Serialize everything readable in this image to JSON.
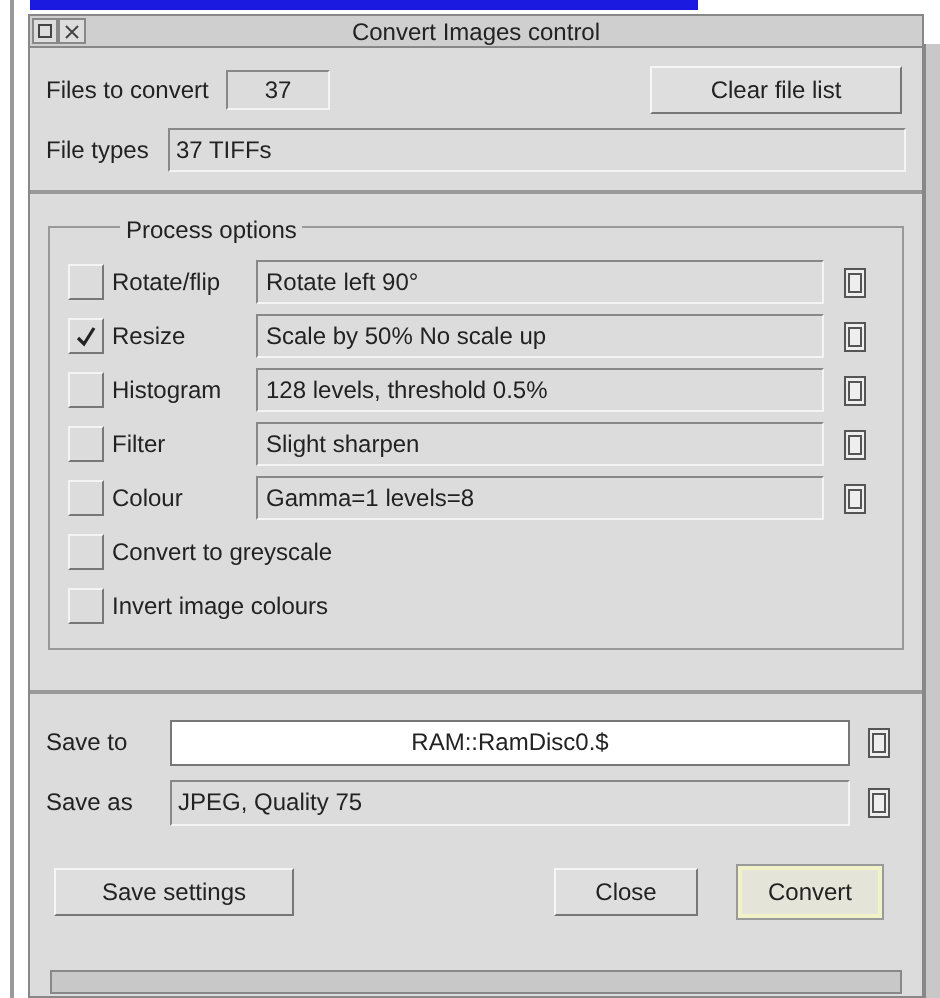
{
  "window": {
    "title": "Convert Images control"
  },
  "files_to_convert": {
    "label": "Files to convert",
    "value": "37"
  },
  "clear_button": {
    "label": "Clear file list"
  },
  "file_types": {
    "label": "File types",
    "value": "37 TIFFs"
  },
  "process_options": {
    "title": "Process options",
    "options": [
      {
        "kind": "field",
        "label": "Rotate/flip",
        "checked": false,
        "value": "Rotate left 90°"
      },
      {
        "kind": "field",
        "label": "Resize",
        "checked": true,
        "value": "Scale by 50% No scale up"
      },
      {
        "kind": "field",
        "label": "Histogram",
        "checked": false,
        "value": "128 levels, threshold 0.5%"
      },
      {
        "kind": "field",
        "label": "Filter",
        "checked": false,
        "value": "Slight sharpen"
      },
      {
        "kind": "field",
        "label": "Colour",
        "checked": false,
        "value": "Gamma=1 levels=8"
      },
      {
        "kind": "plain",
        "label": "Convert to greyscale",
        "checked": false
      },
      {
        "kind": "plain",
        "label": "Invert image colours",
        "checked": false
      }
    ]
  },
  "save_to": {
    "label": "Save to",
    "value": "RAM::RamDisc0.$"
  },
  "save_as": {
    "label": "Save as",
    "value": "JPEG, Quality 75"
  },
  "buttons": [
    {
      "label": "Save settings",
      "default": false
    },
    {
      "label": "Close",
      "default": false
    },
    {
      "label": "Convert",
      "default": true
    }
  ]
}
